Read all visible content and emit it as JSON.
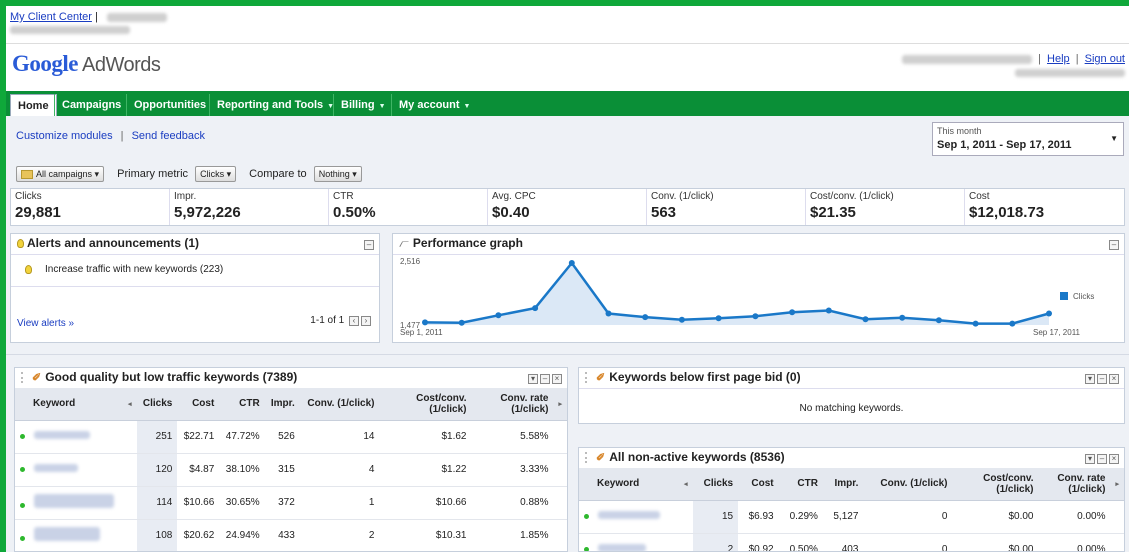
{
  "header": {
    "mcc_link": "My Client Center",
    "mcc_sep": "|",
    "help": "Help",
    "sign_out": "Sign out",
    "links_sep": "|",
    "logo_google": "Google",
    "logo_product": "AdWords"
  },
  "nav": {
    "tabs": [
      {
        "label": "Home"
      },
      {
        "label": "Campaigns"
      },
      {
        "label": "Opportunities"
      },
      {
        "label": "Reporting and Tools"
      },
      {
        "label": "Billing"
      },
      {
        "label": "My account"
      }
    ]
  },
  "toolbar": {
    "customize": "Customize modules",
    "sep": "|",
    "feedback": "Send feedback",
    "date_label": "This month",
    "date_value": "Sep 1, 2011 - Sep 17, 2011",
    "all_campaigns": "All campaigns",
    "primary_metric_label": "Primary metric",
    "primary_metric_value": "Clicks",
    "compare_label": "Compare to",
    "compare_value": "Nothing"
  },
  "metrics": [
    {
      "label": "Clicks",
      "value": "29,881"
    },
    {
      "label": "Impr.",
      "value": "5,972,226"
    },
    {
      "label": "CTR",
      "value": "0.50%"
    },
    {
      "label": "Avg. CPC",
      "value": "$0.40"
    },
    {
      "label": "Conv. (1/click)",
      "value": "563"
    },
    {
      "label": "Cost/conv. (1/click)",
      "value": "$21.35"
    },
    {
      "label": "Cost",
      "value": "$12,018.73"
    }
  ],
  "alerts": {
    "title": "Alerts and announcements (1)",
    "item": "Increase traffic with new keywords (223)",
    "view_all": "View alerts »",
    "pager": "1-1 of 1"
  },
  "graph": {
    "title": "Performance graph",
    "ymax_label": "2,516",
    "ymin_label": "1,477",
    "start_label": "Sep 1, 2011",
    "end_label": "Sep 17, 2011",
    "legend": "Clicks",
    "color": "#1a78c8"
  },
  "chart_data": {
    "type": "area",
    "series": [
      {
        "name": "Clicks",
        "values": [
          1520,
          1515,
          1640,
          1760,
          2516,
          1670,
          1610,
          1565,
          1590,
          1625,
          1690,
          1720,
          1575,
          1600,
          1555,
          1500,
          1500,
          1670
        ]
      }
    ],
    "ylim": [
      1477,
      2516
    ]
  },
  "good_quality": {
    "title": "Good quality but low traffic keywords (7389)",
    "columns": [
      "Keyword",
      "Clicks",
      "Cost",
      "CTR",
      "Impr.",
      "Conv. (1/click)",
      "Cost/conv. (1/click)",
      "Conv. rate (1/click)"
    ],
    "rows": [
      {
        "clicks": "251",
        "cost": "$22.71",
        "ctr": "47.72%",
        "impr": "526",
        "conv": "14",
        "cpc": "$1.62",
        "rate": "5.58%"
      },
      {
        "clicks": "120",
        "cost": "$4.87",
        "ctr": "38.10%",
        "impr": "315",
        "conv": "4",
        "cpc": "$1.22",
        "rate": "3.33%"
      },
      {
        "clicks": "114",
        "cost": "$10.66",
        "ctr": "30.65%",
        "impr": "372",
        "conv": "1",
        "cpc": "$10.66",
        "rate": "0.88%"
      },
      {
        "clicks": "108",
        "cost": "$20.62",
        "ctr": "24.94%",
        "impr": "433",
        "conv": "2",
        "cpc": "$10.31",
        "rate": "1.85%"
      }
    ]
  },
  "below_first": {
    "title": "Keywords below first page bid (0)",
    "empty": "No matching keywords."
  },
  "non_active": {
    "title": "All non-active keywords (8536)",
    "columns": [
      "Keyword",
      "Clicks",
      "Cost",
      "CTR",
      "Impr.",
      "Conv. (1/click)",
      "Cost/conv. (1/click)",
      "Conv. rate (1/click)"
    ],
    "rows": [
      {
        "clicks": "15",
        "cost": "$6.93",
        "ctr": "0.29%",
        "impr": "5,127",
        "conv": "0",
        "cpc": "$0.00",
        "rate": "0.00%"
      },
      {
        "clicks": "2",
        "cost": "$0.92",
        "ctr": "0.50%",
        "impr": "403",
        "conv": "0",
        "cpc": "$0.00",
        "rate": "0.00%"
      }
    ]
  }
}
